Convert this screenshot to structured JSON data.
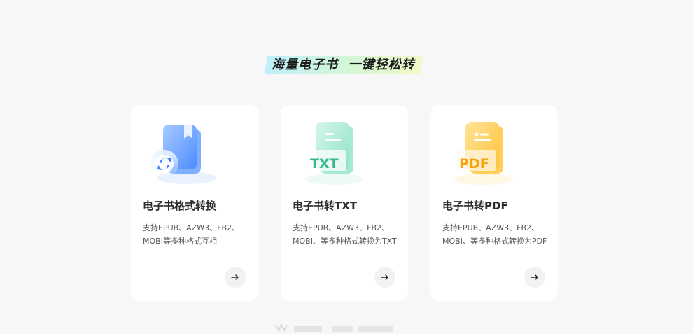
{
  "banner": {
    "text": "海量电子书  一键轻松转"
  },
  "cards": [
    {
      "title": "电子书格式转换",
      "description": "支持EPUB、AZW3、FB2、MOBI等多种格式互相",
      "icon": "ebook-convert-icon",
      "color": "#5b9bff"
    },
    {
      "title": "电子书转TXT",
      "description": "支持EPUB、AZW3、FB2、MOBI、等多种格式转换为TXT",
      "icon_label": "TXT",
      "icon": "txt-file-icon",
      "color": "#5fd3b3"
    },
    {
      "title": "电子书转PDF",
      "description": "支持EPUB、AZW3、FB2、MOBI、等多种格式转换为PDF",
      "icon_label": "PDF",
      "icon": "pdf-file-icon",
      "color": "#ffc534"
    }
  ],
  "arrow_icon": "arrow-right-icon"
}
